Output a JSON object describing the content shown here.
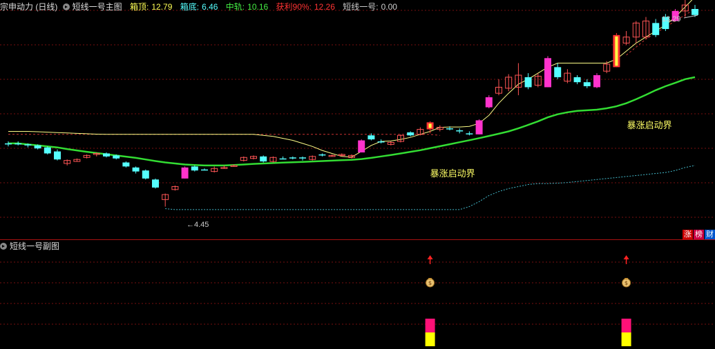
{
  "main_header": {
    "name": "宗申动力 (日线)",
    "indicator": "短线一号主图",
    "items": [
      {
        "label": "箱顶:",
        "value": "12.79",
        "color": "#ffff55"
      },
      {
        "label": "箱底:",
        "value": "6.46",
        "color": "#55ffff"
      },
      {
        "label": "中轨:",
        "value": "10.16",
        "color": "#44ee44"
      },
      {
        "label": "获利90%:",
        "value": "12.26",
        "color": "#ff3333"
      },
      {
        "label": "短线一号:",
        "value": "0.00",
        "color": "#cccccc"
      }
    ]
  },
  "sub_header": {
    "indicator": "短线一号副图"
  },
  "badges": [
    {
      "text": "涨",
      "color": "#cc0000"
    },
    {
      "text": "榜",
      "color": "#cc0044"
    },
    {
      "text": "财",
      "color": "#0055cc"
    }
  ],
  "chart_data": [
    {
      "type": "candlestick",
      "ylim": [
        3.3,
        14.3
      ],
      "annotations": {
        "high_label": "13.29",
        "low_label": "4.45",
        "signal_label": "暴涨启动界"
      },
      "colors": {
        "up": "#ff5555",
        "down": "#55ffff",
        "signal": "#ff33cc",
        "mid": "#33dd33",
        "box_top": "#ffff88",
        "box_bottom": "#44bbcc",
        "profit": "#cc3333"
      },
      "candles": [
        {
          "o": 7.6,
          "h": 7.7,
          "l": 7.45,
          "c": 7.6,
          "s": "d"
        },
        {
          "o": 7.6,
          "h": 7.7,
          "l": 7.5,
          "c": 7.55,
          "s": "d"
        },
        {
          "o": 7.55,
          "h": 7.6,
          "l": 7.4,
          "c": 7.5,
          "s": "d"
        },
        {
          "o": 7.5,
          "h": 7.55,
          "l": 7.3,
          "c": 7.35,
          "s": "d"
        },
        {
          "o": 7.4,
          "h": 7.45,
          "l": 7.05,
          "c": 7.1,
          "s": "d"
        },
        {
          "o": 7.2,
          "h": 7.3,
          "l": 6.75,
          "c": 6.8,
          "s": "d"
        },
        {
          "o": 6.75,
          "h": 6.8,
          "l": 6.5,
          "c": 6.6,
          "s": "u"
        },
        {
          "o": 6.7,
          "h": 6.85,
          "l": 6.7,
          "c": 6.8,
          "s": "u"
        },
        {
          "o": 6.9,
          "h": 7.05,
          "l": 6.85,
          "c": 7.0,
          "s": "u"
        },
        {
          "o": 7.05,
          "h": 7.15,
          "l": 6.95,
          "c": 7.1,
          "s": "u"
        },
        {
          "o": 7.1,
          "h": 7.15,
          "l": 6.9,
          "c": 6.95,
          "s": "d"
        },
        {
          "o": 7.0,
          "h": 7.05,
          "l": 6.8,
          "c": 6.85,
          "s": "d"
        },
        {
          "o": 6.65,
          "h": 6.7,
          "l": 6.4,
          "c": 6.45,
          "s": "d"
        },
        {
          "o": 6.4,
          "h": 6.45,
          "l": 6.1,
          "c": 6.2,
          "s": "d"
        },
        {
          "o": 6.25,
          "h": 6.3,
          "l": 5.8,
          "c": 5.85,
          "s": "d"
        },
        {
          "o": 5.8,
          "h": 5.85,
          "l": 5.35,
          "c": 5.4,
          "s": "d"
        },
        {
          "o": 4.8,
          "h": 5.1,
          "l": 4.45,
          "c": 5.05,
          "s": "u"
        },
        {
          "o": 5.3,
          "h": 5.5,
          "l": 5.25,
          "c": 5.45,
          "s": "u"
        },
        {
          "o": 5.85,
          "h": 6.45,
          "l": 5.85,
          "c": 6.4,
          "s": "m"
        },
        {
          "o": 6.45,
          "h": 6.5,
          "l": 6.2,
          "c": 6.25,
          "s": "d"
        },
        {
          "o": 6.3,
          "h": 6.35,
          "l": 6.25,
          "c": 6.3,
          "s": "d"
        },
        {
          "o": 6.2,
          "h": 6.45,
          "l": 6.15,
          "c": 6.35,
          "s": "u"
        },
        {
          "o": 6.4,
          "h": 6.5,
          "l": 6.35,
          "c": 6.4,
          "s": "u"
        },
        {
          "o": 6.5,
          "h": 6.55,
          "l": 6.45,
          "c": 6.5,
          "s": "u"
        },
        {
          "o": 6.75,
          "h": 6.95,
          "l": 6.7,
          "c": 6.9,
          "s": "u"
        },
        {
          "o": 6.85,
          "h": 7.0,
          "l": 6.8,
          "c": 6.95,
          "s": "u"
        },
        {
          "o": 6.95,
          "h": 7.0,
          "l": 6.65,
          "c": 6.7,
          "s": "d"
        },
        {
          "o": 6.7,
          "h": 6.95,
          "l": 6.65,
          "c": 6.9,
          "s": "u"
        },
        {
          "o": 6.85,
          "h": 6.95,
          "l": 6.8,
          "c": 6.85,
          "s": "d"
        },
        {
          "o": 6.9,
          "h": 6.95,
          "l": 6.8,
          "c": 6.85,
          "s": "d"
        },
        {
          "o": 6.85,
          "h": 6.95,
          "l": 6.75,
          "c": 6.9,
          "s": "d"
        },
        {
          "o": 6.8,
          "h": 7.0,
          "l": 6.75,
          "c": 6.95,
          "s": "u"
        },
        {
          "o": 7.0,
          "h": 7.1,
          "l": 6.95,
          "c": 7.05,
          "s": "d"
        },
        {
          "o": 7.0,
          "h": 7.05,
          "l": 6.95,
          "c": 7.0,
          "s": "u"
        },
        {
          "o": 7.0,
          "h": 7.1,
          "l": 6.95,
          "c": 7.05,
          "s": "u"
        },
        {
          "o": 6.9,
          "h": 7.05,
          "l": 6.85,
          "c": 7.0,
          "s": "u"
        },
        {
          "o": 7.15,
          "h": 7.8,
          "l": 7.15,
          "c": 7.75,
          "s": "m"
        },
        {
          "o": 7.8,
          "h": 8.1,
          "l": 7.75,
          "c": 8.0,
          "s": "d"
        },
        {
          "o": 7.65,
          "h": 7.8,
          "l": 7.6,
          "c": 7.7,
          "s": "d"
        },
        {
          "o": 7.55,
          "h": 7.7,
          "l": 7.5,
          "c": 7.65,
          "s": "u"
        },
        {
          "o": 7.7,
          "h": 8.05,
          "l": 7.65,
          "c": 8.0,
          "s": "u"
        },
        {
          "o": 8.0,
          "h": 8.2,
          "l": 7.95,
          "c": 8.15,
          "s": "d"
        },
        {
          "o": 8.05,
          "h": 8.4,
          "l": 8.0,
          "c": 8.3,
          "s": "u"
        },
        {
          "o": 8.3,
          "h": 8.7,
          "l": 8.1,
          "c": 8.65,
          "s": "y"
        },
        {
          "o": 8.3,
          "h": 8.5,
          "l": 8.2,
          "c": 8.4,
          "s": "u"
        },
        {
          "o": 8.3,
          "h": 8.45,
          "l": 8.25,
          "c": 8.35,
          "s": "d"
        },
        {
          "o": 8.25,
          "h": 8.35,
          "l": 8.1,
          "c": 8.2,
          "s": "d"
        },
        {
          "o": 8.05,
          "h": 8.2,
          "l": 8.0,
          "c": 8.1,
          "s": "d"
        },
        {
          "o": 8.05,
          "h": 8.8,
          "l": 8.05,
          "c": 8.75,
          "s": "m"
        },
        {
          "o": 9.4,
          "h": 10.0,
          "l": 9.35,
          "c": 9.9,
          "s": "m"
        },
        {
          "o": 10.1,
          "h": 10.8,
          "l": 10.0,
          "c": 10.4,
          "s": "u"
        },
        {
          "o": 10.35,
          "h": 11.05,
          "l": 10.2,
          "c": 10.9,
          "s": "u"
        },
        {
          "o": 11.0,
          "h": 11.6,
          "l": 10.0,
          "c": 10.4,
          "s": "u"
        },
        {
          "o": 10.9,
          "h": 11.1,
          "l": 10.3,
          "c": 10.4,
          "s": "d"
        },
        {
          "o": 10.5,
          "h": 11.1,
          "l": 10.4,
          "c": 10.95,
          "s": "u"
        },
        {
          "o": 10.4,
          "h": 11.95,
          "l": 10.4,
          "c": 11.85,
          "s": "m"
        },
        {
          "o": 11.4,
          "h": 11.6,
          "l": 10.8,
          "c": 10.9,
          "s": "d"
        },
        {
          "o": 10.7,
          "h": 11.3,
          "l": 10.6,
          "c": 11.1,
          "s": "u"
        },
        {
          "o": 10.9,
          "h": 11.0,
          "l": 10.55,
          "c": 10.65,
          "s": "d"
        },
        {
          "o": 10.65,
          "h": 10.8,
          "l": 10.35,
          "c": 10.45,
          "s": "d"
        },
        {
          "o": 10.4,
          "h": 11.1,
          "l": 10.35,
          "c": 11.0,
          "s": "m"
        },
        {
          "o": 11.2,
          "h": 11.7,
          "l": 11.1,
          "c": 11.55,
          "s": "u"
        },
        {
          "o": 11.4,
          "h": 13.1,
          "l": 11.4,
          "c": 13.0,
          "s": "y"
        },
        {
          "o": 12.6,
          "h": 13.2,
          "l": 12.5,
          "c": 12.9,
          "s": "u"
        },
        {
          "o": 12.9,
          "h": 13.7,
          "l": 12.6,
          "c": 13.6,
          "s": "u"
        },
        {
          "o": 12.9,
          "h": 13.9,
          "l": 12.8,
          "c": 13.7,
          "s": "u"
        },
        {
          "o": 13.6,
          "h": 13.8,
          "l": 12.9,
          "c": 13.0,
          "s": "d"
        },
        {
          "o": 13.3,
          "h": 14.05,
          "l": 13.2,
          "c": 13.9,
          "s": "d"
        },
        {
          "o": 13.7,
          "h": 14.3,
          "l": 13.7,
          "c": 14.2,
          "s": "m"
        },
        {
          "o": 14.2,
          "h": 14.9,
          "l": 13.9,
          "c": 14.5,
          "s": "u"
        },
        {
          "o": 14.3,
          "h": 14.5,
          "l": 13.9,
          "c": 14.0,
          "s": "d"
        }
      ],
      "series": [
        {
          "key": "mid",
          "values": [
            7.6,
            7.6,
            7.55,
            7.5,
            7.45,
            7.4,
            7.32,
            7.25,
            7.18,
            7.12,
            7.06,
            7.0,
            6.94,
            6.88,
            6.8,
            6.72,
            6.65,
            6.6,
            6.55,
            6.52,
            6.5,
            6.5,
            6.5,
            6.52,
            6.55,
            6.58,
            6.6,
            6.62,
            6.64,
            6.66,
            6.68,
            6.7,
            6.72,
            6.74,
            6.76,
            6.78,
            6.82,
            6.88,
            6.95,
            7.02,
            7.1,
            7.18,
            7.26,
            7.36,
            7.46,
            7.56,
            7.66,
            7.76,
            7.86,
            7.97,
            8.08,
            8.2,
            8.35,
            8.52,
            8.7,
            8.9,
            9.05,
            9.15,
            9.22,
            9.25,
            9.28,
            9.35,
            9.45,
            9.6,
            9.8,
            10.02,
            10.25,
            10.45,
            10.62,
            10.8,
            10.9
          ]
        },
        {
          "key": "box_top",
          "values": [
            8.2,
            8.2,
            8.2,
            8.18,
            8.16,
            8.14,
            8.12,
            8.1,
            8.08,
            8.06,
            8.05,
            8.05,
            8.05,
            8.05,
            8.05,
            8.05,
            8.05,
            8.05,
            8.05,
            8.05,
            8.05,
            8.05,
            8.05,
            8.05,
            8.05,
            8.05,
            8.0,
            7.95,
            7.85,
            7.75,
            7.6,
            7.45,
            7.25,
            7.1,
            6.95,
            6.92,
            7.2,
            7.5,
            7.7,
            7.72,
            7.8,
            7.9,
            8.05,
            8.2,
            8.4,
            8.42,
            8.42,
            8.45,
            8.6,
            9.0,
            9.6,
            10.1,
            10.55,
            10.8,
            11.1,
            11.4,
            11.6,
            11.6,
            11.6,
            11.6,
            11.6,
            11.6,
            11.8,
            12.2,
            12.6,
            12.9,
            13.2,
            13.5,
            13.9,
            14.4,
            14.9
          ]
        },
        {
          "key": "box_bottom",
          "values": [
            null,
            null,
            null,
            null,
            null,
            null,
            null,
            null,
            null,
            null,
            null,
            null,
            null,
            null,
            null,
            null,
            4.35,
            4.3,
            4.3,
            4.3,
            4.3,
            4.3,
            4.3,
            4.3,
            4.3,
            4.3,
            4.3,
            4.3,
            4.3,
            4.3,
            4.3,
            4.3,
            4.3,
            4.3,
            4.3,
            4.3,
            4.3,
            4.3,
            4.3,
            4.3,
            4.3,
            4.3,
            4.3,
            4.3,
            4.3,
            4.3,
            4.3,
            4.45,
            4.7,
            5.0,
            5.2,
            5.35,
            5.45,
            5.55,
            5.6,
            5.6,
            5.62,
            5.65,
            5.7,
            5.75,
            5.8,
            5.85,
            5.9,
            5.95,
            6.0,
            6.05,
            6.1,
            6.15,
            6.25,
            6.4,
            6.5
          ]
        },
        {
          "key": "profit",
          "values": [
            8.05,
            8.05,
            8.05,
            8.05,
            8.05,
            8.05,
            8.05,
            8.05,
            8.05,
            8.05,
            8.05,
            8.05,
            8.05,
            8.05,
            8.05,
            8.05,
            8.05,
            8.05,
            8.05,
            8.05,
            8.05,
            8.05,
            8.05,
            8.05,
            8.05,
            8.05,
            8.05,
            8.05,
            8.05,
            8.05,
            8.05,
            8.05,
            8.05,
            8.05,
            8.05,
            8.05,
            8.05,
            8.05,
            8.05,
            8.05,
            8.05,
            8.05,
            8.05,
            8.05,
            8.0,
            null,
            null,
            null,
            null,
            null,
            null,
            null,
            null,
            null,
            null,
            null,
            null,
            null,
            null,
            null,
            null,
            null,
            null,
            12.0,
            12.4,
            12.8,
            13.1,
            13.4,
            13.7,
            14.0,
            14.3
          ]
        }
      ],
      "signals": [
        43,
        63
      ],
      "sub": {
        "arrows": [
          43,
          63
        ],
        "money_bags": [
          43,
          63
        ],
        "bars": [
          43,
          63
        ]
      }
    }
  ]
}
